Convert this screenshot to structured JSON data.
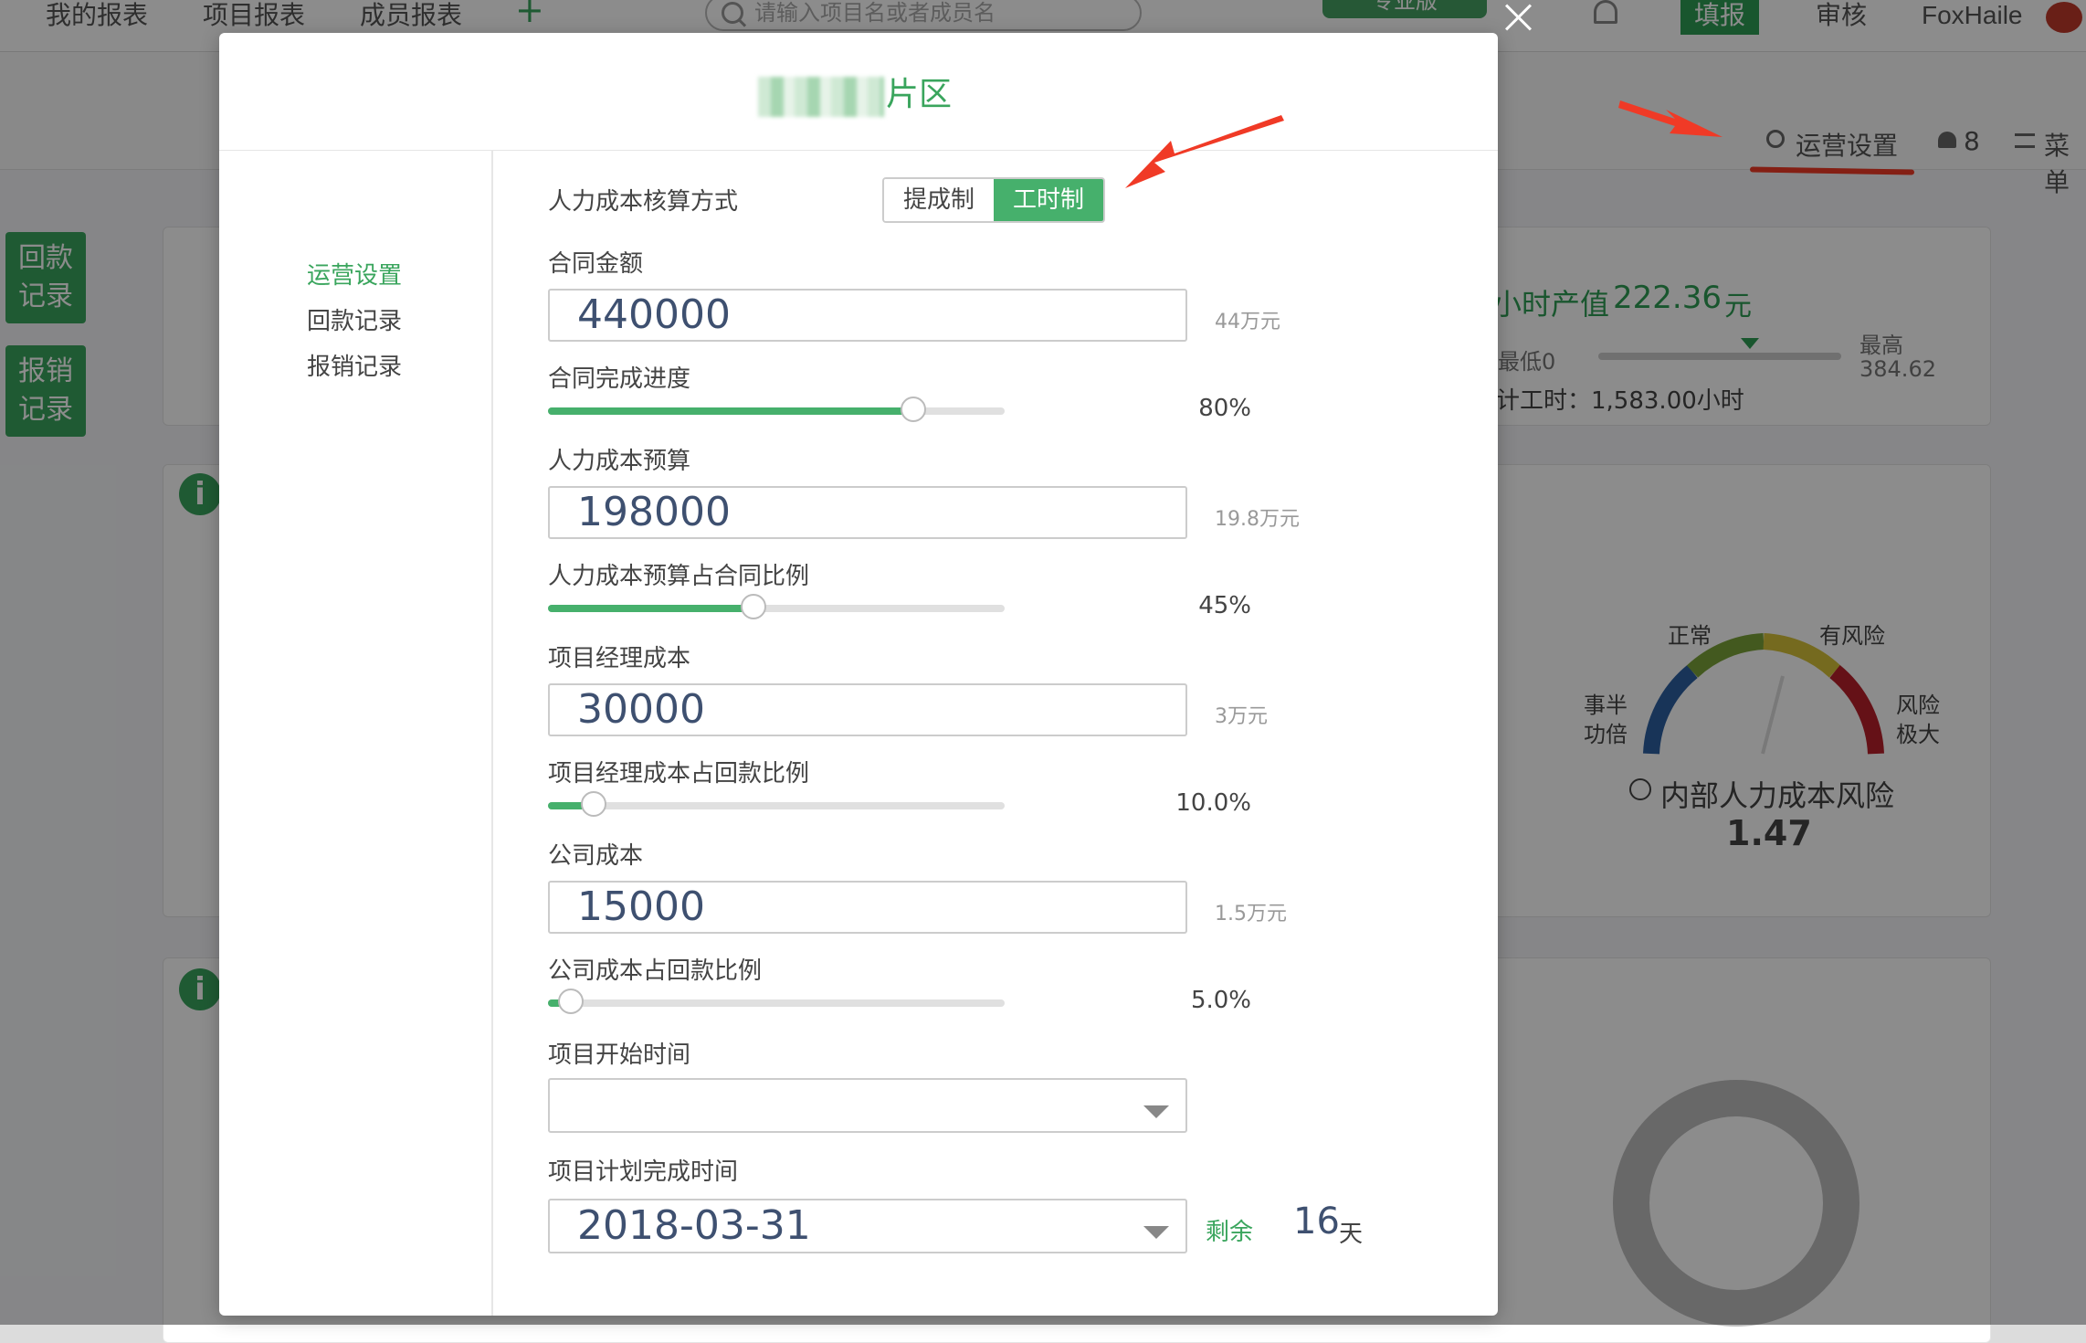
{
  "topbar": {
    "nav": [
      "我的报表",
      "项目报表",
      "成员报表"
    ],
    "add": "+",
    "search_placeholder": "请输入项目名或者成员名",
    "pro_tab": "专业版",
    "fill_button": "填报",
    "review": "审核",
    "user": "FoxHaile"
  },
  "subbar": {
    "ops_settings": "运营设置",
    "members_count": "8",
    "menu": "菜单"
  },
  "side_buttons": [
    "回款\n记录",
    "报销\n记录"
  ],
  "background": {
    "hourly_value_label": "小时产值",
    "hourly_value": "222.36",
    "hourly_unit": "元",
    "min_label": "最低0",
    "max_label": "最高",
    "max_value": "384.62",
    "total_hours": "计工时：1,583.00小时",
    "gauge_labels": [
      "正常",
      "有风险",
      "事半功倍",
      "风险极大"
    ],
    "risk_title": "内部人力成本风险",
    "risk_value": "1.47"
  },
  "modal": {
    "title_suffix": "片区",
    "menu": [
      {
        "label": "运营设置",
        "active": true
      },
      {
        "label": "回款记录",
        "active": false
      },
      {
        "label": "报销记录",
        "active": false
      }
    ],
    "cost_method": {
      "label": "人力成本核算方式",
      "options": [
        "提成制",
        "工时制"
      ],
      "selected": "工时制"
    },
    "fields": {
      "contract_amount": {
        "label": "合同金额",
        "value": "440000",
        "hint": "44万元"
      },
      "contract_progress": {
        "label": "合同完成进度",
        "value": 0.8,
        "display": "80%"
      },
      "labor_budget": {
        "label": "人力成本预算",
        "value": "198000",
        "hint": "19.8万元"
      },
      "labor_ratio": {
        "label": "人力成本预算占合同比例",
        "value": 0.45,
        "display": "45%"
      },
      "pm_cost": {
        "label": "项目经理成本",
        "value": "30000",
        "hint": "3万元"
      },
      "pm_ratio": {
        "label": "项目经理成本占回款比例",
        "value": 0.1,
        "display": "10.0%"
      },
      "company_cost": {
        "label": "公司成本",
        "value": "15000",
        "hint": "1.5万元"
      },
      "company_ratio": {
        "label": "公司成本占回款比例",
        "value": 0.05,
        "display": "5.0%"
      },
      "start_date": {
        "label": "项目开始时间",
        "value": ""
      },
      "end_date": {
        "label": "项目计划完成时间",
        "value": "2018-03-31"
      }
    },
    "remaining": {
      "label": "剩余",
      "value": "16",
      "unit": "天"
    }
  },
  "colors": {
    "accent": "#46b06c",
    "arrow": "#f03a26",
    "input_text": "#3e5070"
  }
}
